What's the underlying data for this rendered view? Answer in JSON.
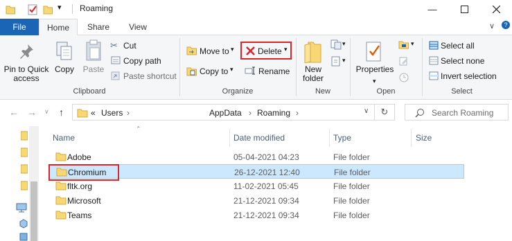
{
  "window": {
    "title": "Roaming"
  },
  "ribbon_tabs": [
    {
      "label": "File"
    },
    {
      "label": "Home"
    },
    {
      "label": "Share"
    },
    {
      "label": "View"
    }
  ],
  "ribbon": {
    "clipboard": {
      "pin_label_1": "Pin to Quick",
      "pin_label_2": "access",
      "copy": "Copy",
      "paste": "Paste",
      "cut": "Cut",
      "copy_path": "Copy path",
      "paste_shortcut": "Paste shortcut",
      "group": "Clipboard"
    },
    "organize": {
      "move_to": "Move to",
      "copy_to": "Copy to",
      "delete": "Delete",
      "rename": "Rename",
      "group": "Organize"
    },
    "new": {
      "new_folder_1": "New",
      "new_folder_2": "folder",
      "group": "New"
    },
    "open": {
      "properties": "Properties",
      "group": "Open"
    },
    "select": {
      "select_all": "Select all",
      "select_none": "Select none",
      "invert": "Invert selection",
      "group": "Select"
    }
  },
  "address": {
    "overflow": "«",
    "parts": [
      "Users",
      "AppData",
      "Roaming"
    ],
    "search_placeholder": "Search Roaming"
  },
  "columns": [
    "Name",
    "Date modified",
    "Type",
    "Size"
  ],
  "files": [
    {
      "name": "Adobe",
      "date": "05-04-2021 04:23",
      "type": "File folder"
    },
    {
      "name": "Chromium",
      "date": "26-12-2021 12:40",
      "type": "File folder"
    },
    {
      "name": "fltk.org",
      "date": "11-02-2021 05:45",
      "type": "File folder"
    },
    {
      "name": "Microsoft",
      "date": "21-12-2021 09:34",
      "type": "File folder"
    },
    {
      "name": "Teams",
      "date": "21-12-2021 09:34",
      "type": "File folder"
    }
  ],
  "selected_file": "Chromium",
  "colors": {
    "accent": "#1a65b5",
    "selection": "#cce8ff",
    "highlight_box": "#d9262b",
    "folder": "#f8d775"
  }
}
